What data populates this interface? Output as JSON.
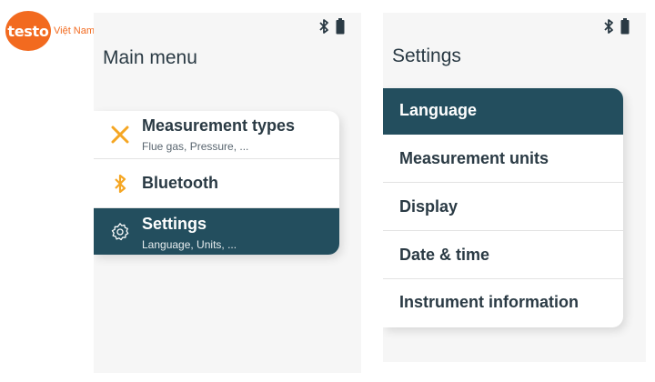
{
  "logo": {
    "word": "testo",
    "suffix": "Việt Nam"
  },
  "left_screen": {
    "title": "Main menu",
    "status_icons": [
      "bluetooth-icon",
      "battery-icon"
    ],
    "items": [
      {
        "label": "Measurement types",
        "subtitle": "Flue gas, Pressure, ...",
        "icon": "measurement-cross-icon",
        "selected": false
      },
      {
        "label": "Bluetooth",
        "subtitle": "",
        "icon": "bluetooth-icon",
        "selected": false
      },
      {
        "label": "Settings",
        "subtitle": "Language, Units, ...",
        "icon": "gear-icon",
        "selected": true
      }
    ]
  },
  "right_screen": {
    "title": "Settings",
    "status_icons": [
      "bluetooth-icon",
      "battery-icon"
    ],
    "items": [
      {
        "label": "Language",
        "selected": true
      },
      {
        "label": "Measurement units",
        "selected": false
      },
      {
        "label": "Display",
        "selected": false
      },
      {
        "label": "Date & time",
        "selected": false
      },
      {
        "label": "Instrument information",
        "selected": false
      }
    ]
  },
  "colors": {
    "selected_bg": "#234e5e",
    "accent_orange": "#f5a623",
    "logo_orange": "#f26a1f",
    "text_dark": "#2a3a44"
  }
}
